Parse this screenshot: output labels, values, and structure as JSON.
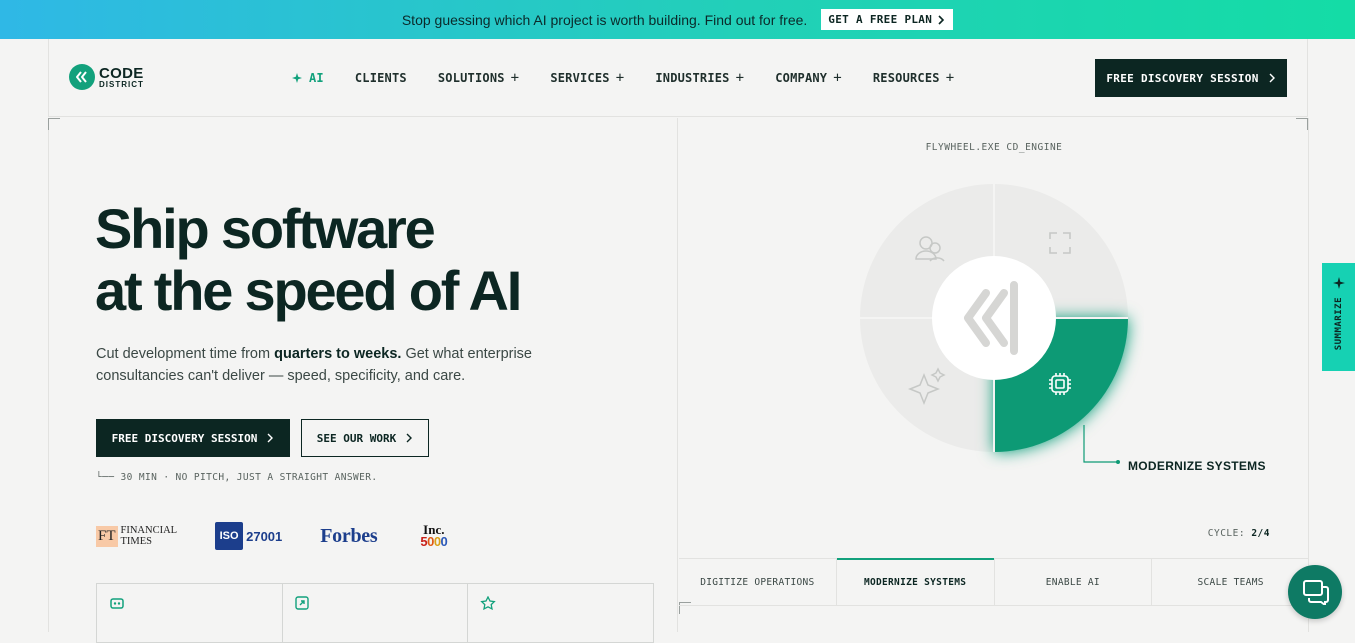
{
  "banner": {
    "text": "Stop guessing which AI project is worth building. Find out for free.",
    "cta_label": "GET A FREE PLAN"
  },
  "nav": {
    "logo_code": "CODE",
    "logo_district": "DISTRICT",
    "items": [
      {
        "label": "AI",
        "icon": "sparkle-icon",
        "expandable": false
      },
      {
        "label": "CLIENTS",
        "expandable": false
      },
      {
        "label": "SOLUTIONS",
        "expandable": true
      },
      {
        "label": "SERVICES",
        "expandable": true
      },
      {
        "label": "INDUSTRIES",
        "expandable": true
      },
      {
        "label": "COMPANY",
        "expandable": true
      },
      {
        "label": "RESOURCES",
        "expandable": true
      }
    ],
    "cta_label": "FREE DISCOVERY SESSION"
  },
  "hero": {
    "title_line1": "Ship software",
    "title_line2": "at the speed of AI",
    "subtitle_pre": "Cut development time from ",
    "subtitle_bold": "quarters to weeks.",
    "subtitle_post": " Get what enterprise consultancies can't deliver — speed, specificity, and care.",
    "primary_cta": "FREE DISCOVERY SESSION",
    "secondary_cta": "SEE OUR WORK",
    "note": "└── 30 MIN · NO PITCH, JUST A STRAIGHT ANSWER."
  },
  "logos": {
    "ft_mark": "FT",
    "ft_line1": "FINANCIAL",
    "ft_line2": "TIMES",
    "iso_mark": "ISO",
    "iso_number": "27001",
    "forbes": "Forbes",
    "inc_title": "Inc.",
    "inc_number": [
      "5",
      "0",
      "0",
      "0"
    ]
  },
  "flywheel": {
    "engine_label": "FLYWHEEL.EXE CD_ENGINE",
    "active_label": "MODERNIZE SYSTEMS",
    "cycle_label": "CYCLE:",
    "cycle_value": "2/4",
    "tabs": [
      {
        "label": "DIGITIZE OPERATIONS",
        "active": false
      },
      {
        "label": "MODERNIZE SYSTEMS",
        "active": true
      },
      {
        "label": "ENABLE AI",
        "active": false
      },
      {
        "label": "SCALE TEAMS",
        "active": false
      }
    ]
  },
  "summarize": {
    "label": "SUMMARIZE"
  },
  "colors": {
    "accent": "#12a17c",
    "dark": "#0c2622",
    "wheel_gray": "#e9e9e8"
  }
}
